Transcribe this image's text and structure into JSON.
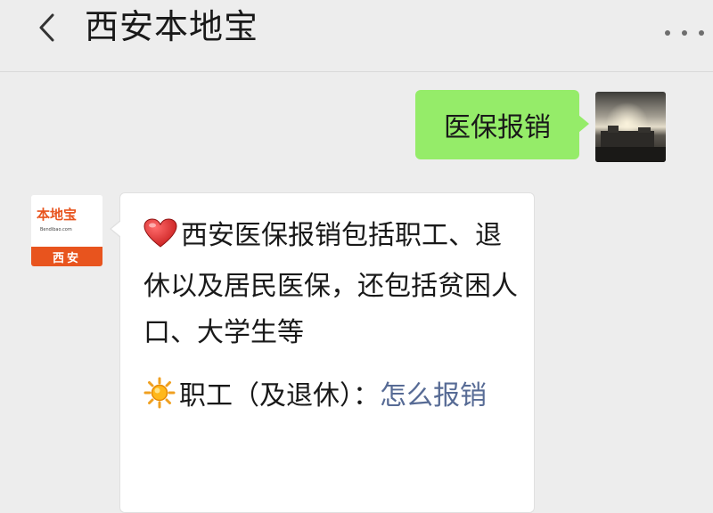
{
  "header": {
    "title": "西安本地宝",
    "back_icon": "chevron-left-icon",
    "more_icon": "more-dots-icon"
  },
  "messages": {
    "outgoing": {
      "text": "医保报销"
    },
    "incoming": {
      "avatar": {
        "brand": "本地宝",
        "url": "Bendibao.com",
        "city": "西安"
      },
      "paragraph1": {
        "icon": "heart-icon",
        "text": "西安医保报销包括职工、退休以及居民医保，还包括贫困人口、大学生等"
      },
      "paragraph2": {
        "icon": "sun-icon",
        "text": "职工（及退休）：",
        "link": "怎么报销"
      }
    }
  },
  "colors": {
    "background": "#ededed",
    "outgoing_bubble": "#95ec69",
    "incoming_bubble": "#ffffff",
    "link": "#576b95",
    "brand": "#e8541e"
  }
}
